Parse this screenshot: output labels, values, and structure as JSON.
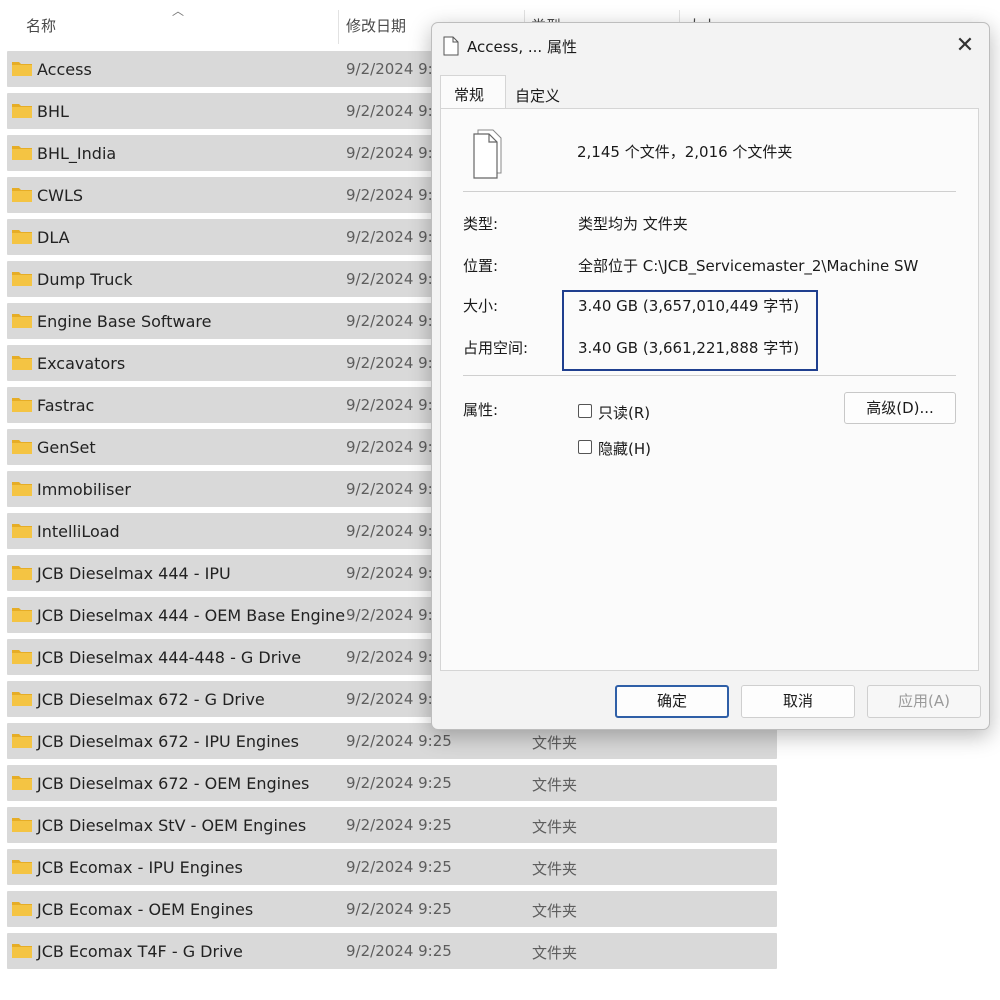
{
  "explorer": {
    "columns": {
      "name": "名称",
      "modified": "修改日期",
      "type": "类型",
      "size": "大小"
    },
    "rows": [
      {
        "name": "Access",
        "date": "9/2/2024 9:",
        "type": ""
      },
      {
        "name": "BHL",
        "date": "9/2/2024 9:",
        "type": ""
      },
      {
        "name": "BHL_India",
        "date": "9/2/2024 9:",
        "type": ""
      },
      {
        "name": "CWLS",
        "date": "9/2/2024 9:",
        "type": ""
      },
      {
        "name": "DLA",
        "date": "9/2/2024 9:",
        "type": ""
      },
      {
        "name": "Dump Truck",
        "date": "9/2/2024 9:",
        "type": ""
      },
      {
        "name": "Engine Base Software",
        "date": "9/2/2024 9:",
        "type": ""
      },
      {
        "name": "Excavators",
        "date": "9/2/2024 9:",
        "type": ""
      },
      {
        "name": "Fastrac",
        "date": "9/2/2024 9:",
        "type": ""
      },
      {
        "name": "GenSet",
        "date": "9/2/2024 9:",
        "type": ""
      },
      {
        "name": "Immobiliser",
        "date": "9/2/2024 9:",
        "type": ""
      },
      {
        "name": "IntelliLoad",
        "date": "9/2/2024 9:",
        "type": ""
      },
      {
        "name": "JCB Dieselmax 444 - IPU",
        "date": "9/2/2024 9:",
        "type": ""
      },
      {
        "name": "JCB Dieselmax 444 - OEM Base Engine",
        "date": "9/2/2024 9:",
        "type": ""
      },
      {
        "name": "JCB Dieselmax 444-448 - G Drive",
        "date": "9/2/2024 9:",
        "type": ""
      },
      {
        "name": "JCB Dieselmax 672 - G Drive",
        "date": "9/2/2024 9:",
        "type": ""
      },
      {
        "name": "JCB Dieselmax 672 - IPU Engines",
        "date": "9/2/2024 9:25",
        "type": "文件夹"
      },
      {
        "name": "JCB Dieselmax 672 - OEM Engines",
        "date": "9/2/2024 9:25",
        "type": "文件夹"
      },
      {
        "name": "JCB Dieselmax StV - OEM Engines",
        "date": "9/2/2024 9:25",
        "type": "文件夹"
      },
      {
        "name": "JCB Ecomax - IPU Engines",
        "date": "9/2/2024 9:25",
        "type": "文件夹"
      },
      {
        "name": "JCB Ecomax - OEM Engines",
        "date": "9/2/2024 9:25",
        "type": "文件夹"
      },
      {
        "name": "JCB Ecomax T4F - G Drive",
        "date": "9/2/2024 9:25",
        "type": "文件夹"
      }
    ]
  },
  "dialog": {
    "title": "Access, ... 属性",
    "close": "✕",
    "tabs": {
      "general": "常规",
      "custom": "自定义"
    },
    "summary": "2,145 个文件，2,016 个文件夹",
    "type_label": "类型:",
    "type_value": "类型均为 文件夹",
    "location_label": "位置:",
    "location_value": "全部位于 C:\\JCB_Servicemaster_2\\Machine SW",
    "size_label": "大小:",
    "size_value": "3.40 GB (3,657,010,449 字节)",
    "disk_label": "占用空间:",
    "disk_value": "3.40 GB (3,661,221,888 字节)",
    "attributes_label": "属性:",
    "readonly_label": "只读(R)",
    "hidden_label": "隐藏(H)",
    "advanced_label": "高级(D)...",
    "ok_label": "确定",
    "cancel_label": "取消",
    "apply_label": "应用(A)"
  },
  "colors": {
    "row_bg": "#d9d9d9",
    "folder": "#f4c443",
    "highlight_box": "#1f3f8f",
    "ok_border": "#2f5fa7"
  }
}
